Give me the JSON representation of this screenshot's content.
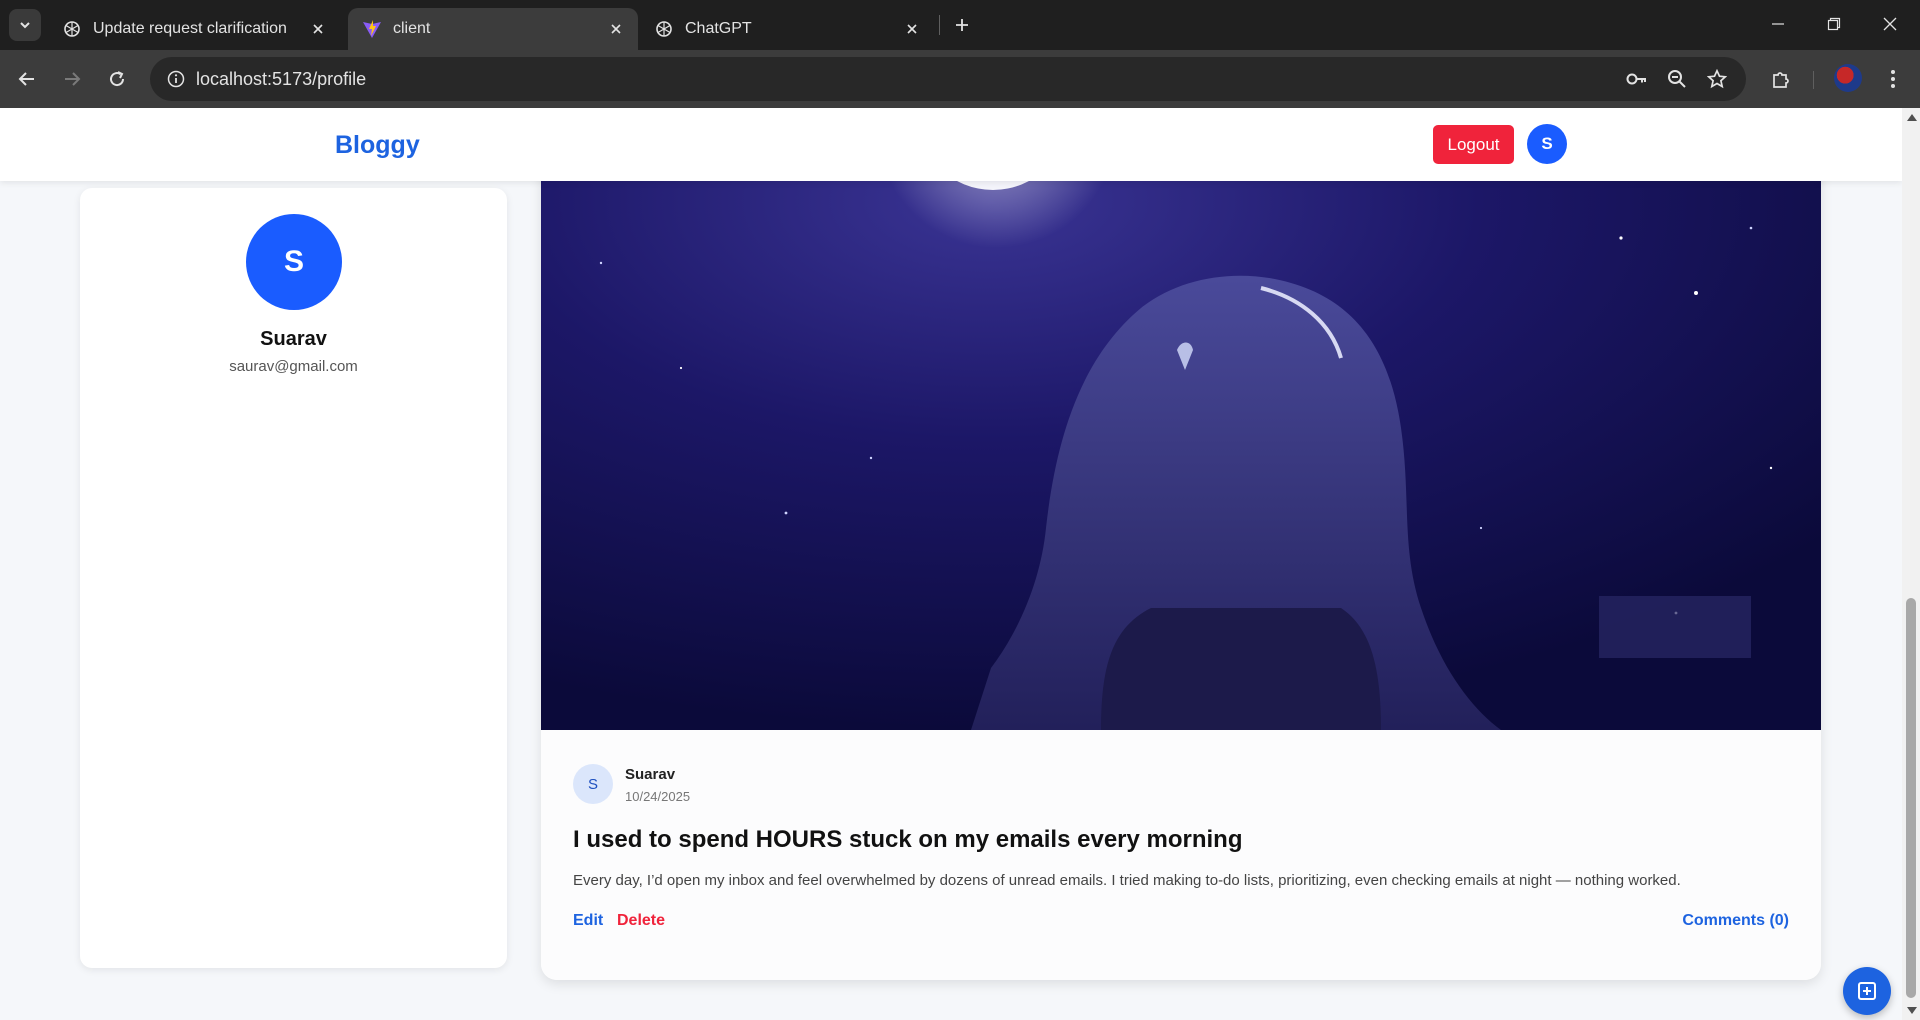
{
  "browser": {
    "tabs": [
      {
        "title": "Update request clarification",
        "icon": "openai-icon",
        "active": false
      },
      {
        "title": "client",
        "icon": "vite-icon",
        "active": true
      },
      {
        "title": "ChatGPT",
        "icon": "openai-icon",
        "active": false
      }
    ],
    "url": "localhost:5173/profile"
  },
  "navbar": {
    "brand": "Bloggy",
    "logout_label": "Logout",
    "avatar_initial": "S"
  },
  "profile": {
    "initial": "S",
    "name": "Suarav",
    "email": "saurav@gmail.com"
  },
  "post": {
    "image_subject": "blue-lit statue under moonlit night sky",
    "author_initial": "S",
    "author": "Suarav",
    "date": "10/24/2025",
    "title": "I used to spend HOURS stuck on my emails every morning",
    "excerpt": "Every day, I’d open my inbox and feel overwhelmed by dozens of unread emails. I tried making to-do lists, prioritizing, even checking emails at night — nothing worked.",
    "edit_label": "Edit",
    "delete_label": "Delete",
    "comments_label": "Comments (0)"
  },
  "colors": {
    "accent": "#1d63e0",
    "danger": "#f0233b",
    "avatar": "#1a5cff",
    "page_bg": "#f5f7fa"
  }
}
